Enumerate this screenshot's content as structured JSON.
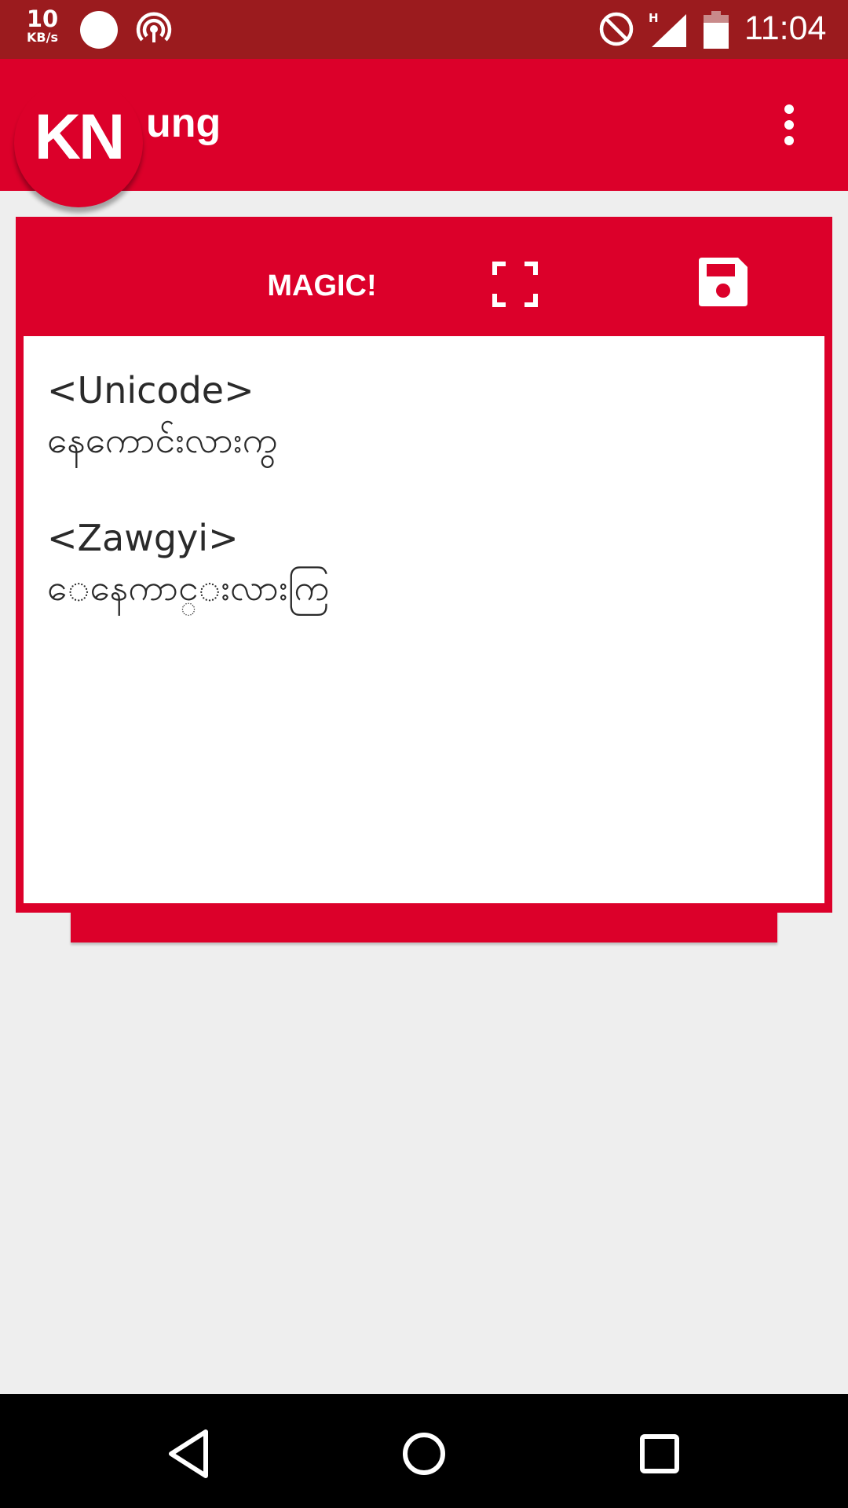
{
  "status_bar": {
    "speed_value": "10",
    "speed_unit": "KB/s",
    "network_type": "H",
    "time": "11:04"
  },
  "app_bar": {
    "logo_text": "KN",
    "title": "ung"
  },
  "toolbar": {
    "magic_label": "MAGIC!"
  },
  "text_area": {
    "unicode_label": "<Unicode>",
    "unicode_text": "နေကောင်းလားကွ",
    "zawgyi_label": "<Zawgyi>",
    "zawgyi_text": "ေနေကာင္းလားကြ"
  },
  "colors": {
    "status_bar": "#9b1b1e",
    "accent": "#dc002a",
    "background": "#eeeeee",
    "nav_bar": "#000000"
  },
  "icons": {
    "status": [
      "status-dot-icon",
      "hotspot-icon",
      "do-not-disturb-icon",
      "signal-icon",
      "battery-icon"
    ],
    "toolbar": [
      "fullscreen-icon",
      "save-icon"
    ],
    "app_bar": [
      "overflow-menu-icon"
    ],
    "nav": [
      "back-icon",
      "home-icon",
      "recents-icon"
    ]
  }
}
